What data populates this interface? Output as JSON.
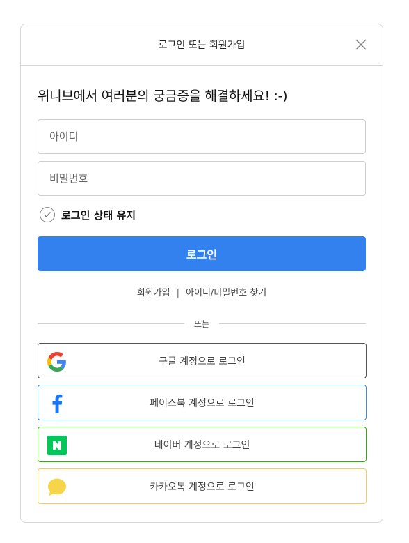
{
  "header": {
    "title": "로그인 또는 회원가입"
  },
  "headline": "위니브에서 여러분의 궁금증을 해결하세요! :-)",
  "form": {
    "id_placeholder": "아이디",
    "pw_placeholder": "비밀번호",
    "keep_login_label": "로그인 상태 유지",
    "login_label": "로그인"
  },
  "links": {
    "signup": "회원가입",
    "separator": "|",
    "find": "아이디/비밀번호 찾기"
  },
  "divider_text": "또는",
  "social": {
    "google": "구글 계정으로 로그인",
    "facebook": "페이스북 계정으로 로그인",
    "naver": "네이버 계정으로 로그인",
    "kakao": "카카오톡 계정으로 로그인"
  },
  "colors": {
    "primary": "#3381ee",
    "facebook": "#1877f2",
    "naver": "#03c75a",
    "kakao": "#f7d54a"
  }
}
